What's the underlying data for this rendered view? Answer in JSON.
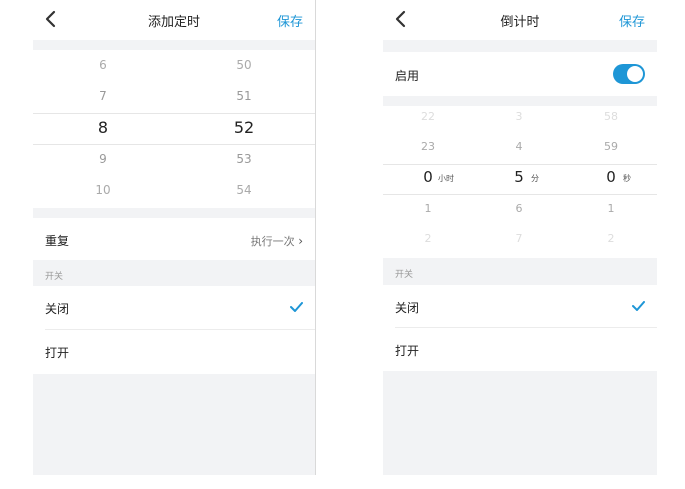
{
  "left": {
    "header": {
      "title": "添加定时",
      "save_label": "保存"
    },
    "picker": {
      "col1": [
        "6",
        "7",
        "8",
        "9",
        "10"
      ],
      "col2": [
        "50",
        "51",
        "52",
        "53",
        "54"
      ]
    },
    "repeat": {
      "label": "重复",
      "value": "执行一次"
    },
    "section_label": "开关",
    "options": [
      {
        "label": "关闭",
        "selected": true
      },
      {
        "label": "打开",
        "selected": false
      }
    ]
  },
  "right": {
    "header": {
      "title": "倒计时",
      "save_label": "保存"
    },
    "enable": {
      "label": "启用",
      "on": true
    },
    "picker": {
      "hours": [
        "22",
        "23",
        "0",
        "1",
        "2"
      ],
      "minutes": [
        "3",
        "4",
        "5",
        "6",
        "7"
      ],
      "seconds": [
        "58",
        "59",
        "0",
        "1",
        "2"
      ],
      "hour_unit": "小时",
      "minute_unit": "分",
      "second_unit": "秒"
    },
    "section_label": "开关",
    "options": [
      {
        "label": "关闭",
        "selected": true
      },
      {
        "label": "打开",
        "selected": false
      }
    ]
  },
  "colors": {
    "accent": "#1e96d6",
    "gray_bg": "#f2f3f5"
  }
}
